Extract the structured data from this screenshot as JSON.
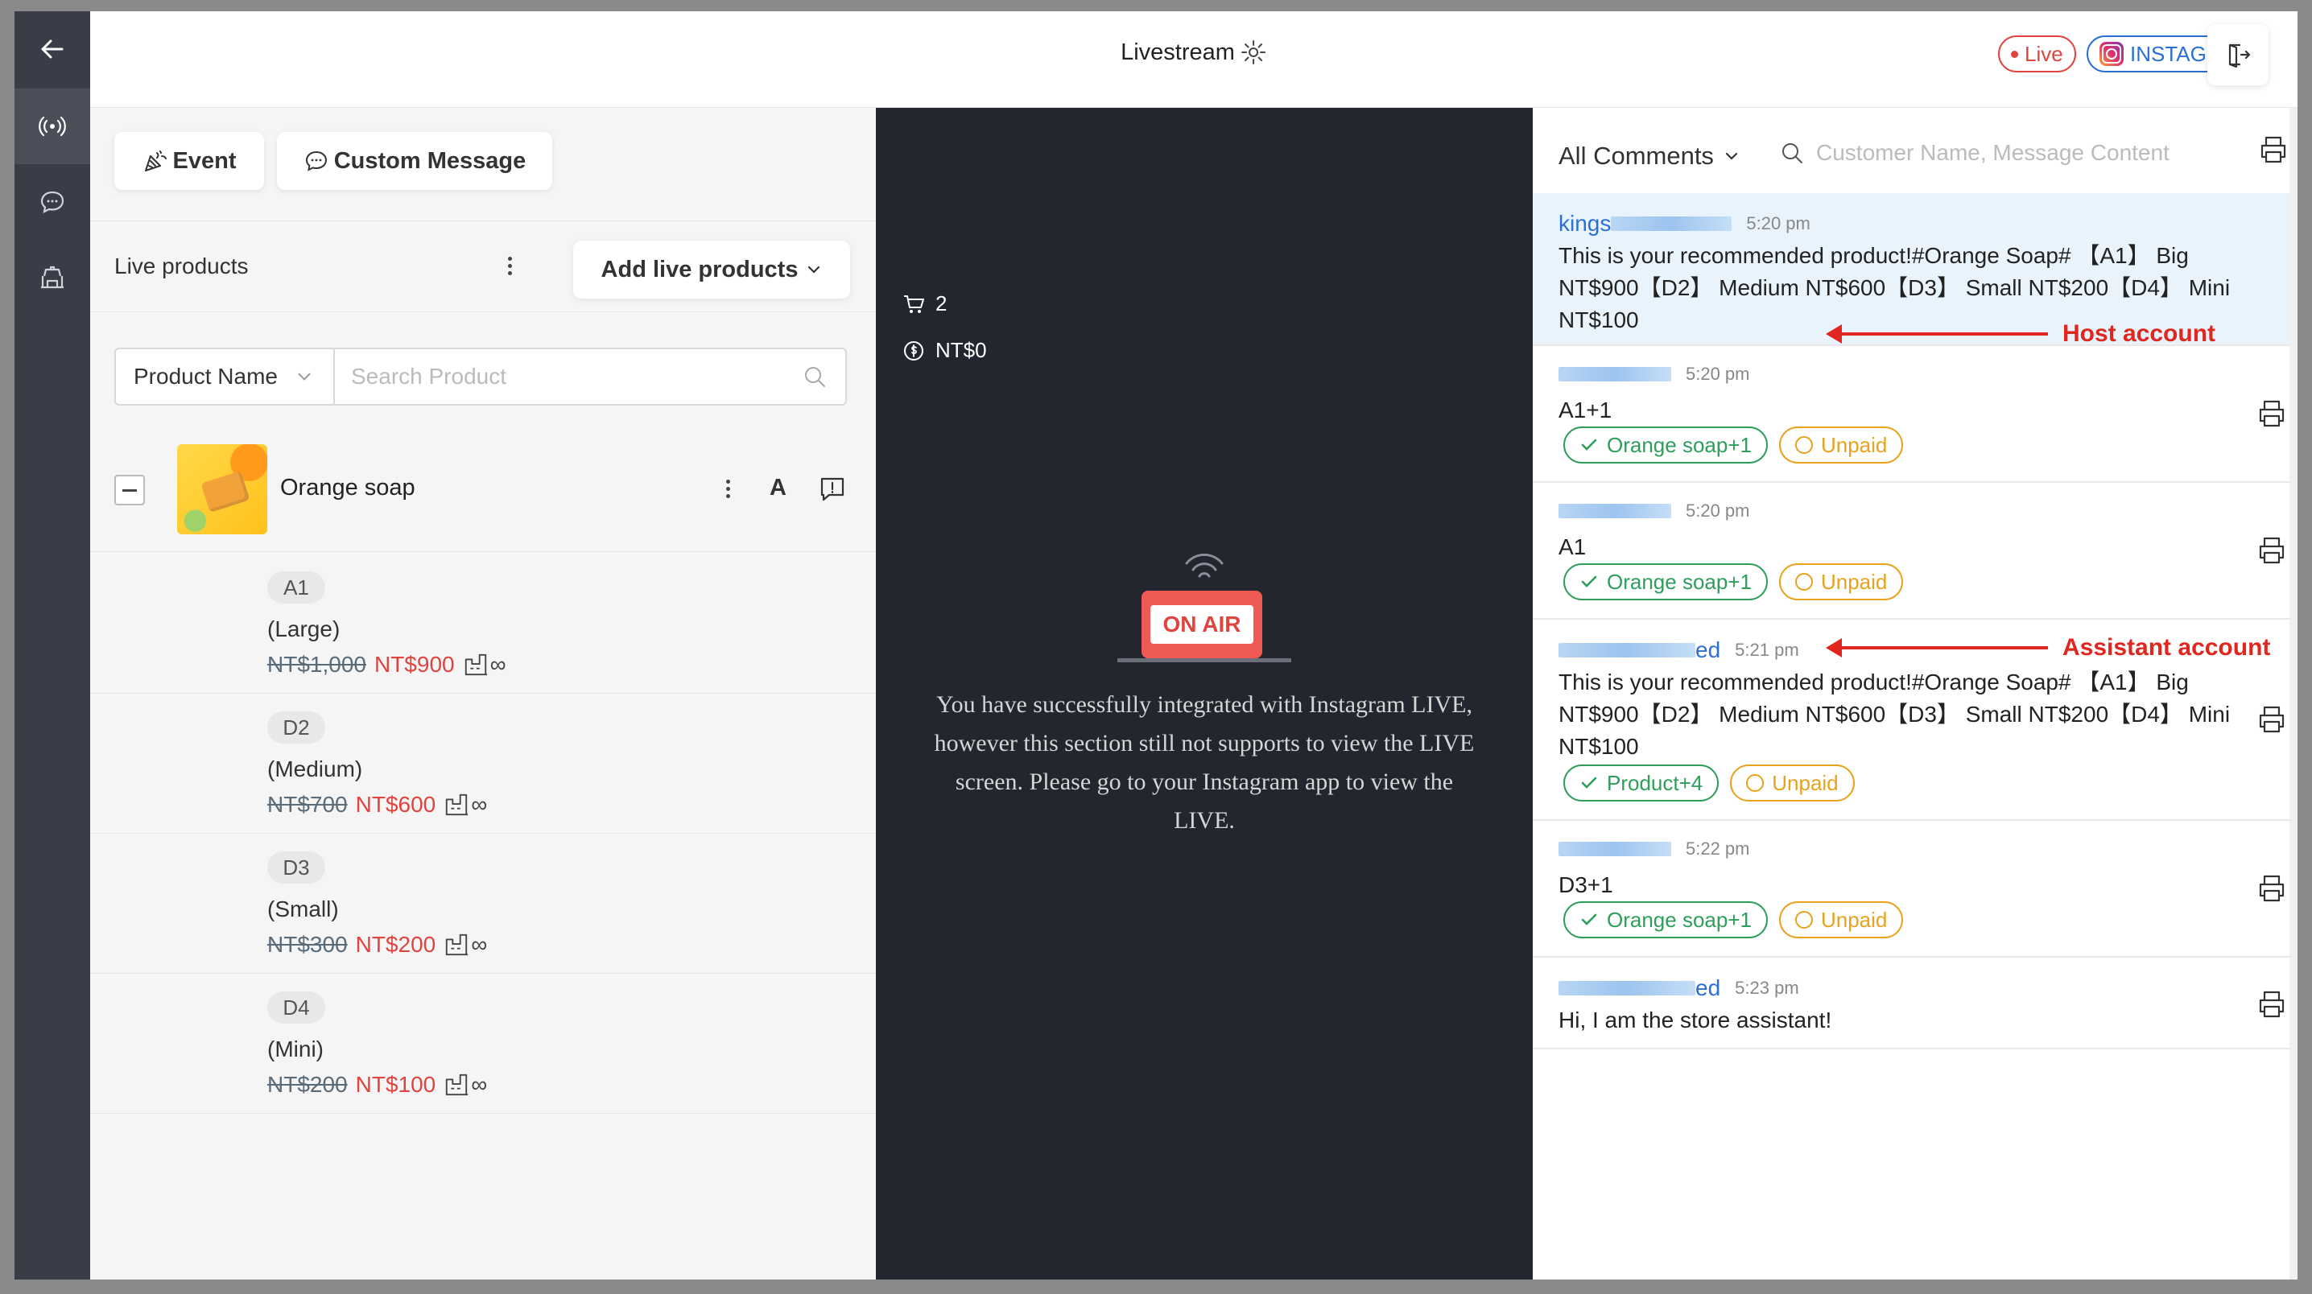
{
  "header": {
    "title": "Livestream",
    "live_label": "Live",
    "platform_label": "INSTAGRAM"
  },
  "rail": {
    "items": [
      "back-arrow-icon",
      "broadcast-icon",
      "chat-icon",
      "store-icon"
    ]
  },
  "left": {
    "event_label": "Event",
    "custom_message_label": "Custom Message",
    "live_products_label": "Live products",
    "add_live_products_label": "Add live products",
    "filter_select": "Product Name",
    "search_placeholder": "Search Product",
    "product": {
      "name": "Orange soap",
      "letter_button": "A"
    },
    "variants": [
      {
        "code": "A1",
        "size": "(Large)",
        "original": "NT$1,000",
        "price": "NT$900",
        "stock": "∞"
      },
      {
        "code": "D2",
        "size": "(Medium)",
        "original": "NT$700",
        "price": "NT$600",
        "stock": "∞"
      },
      {
        "code": "D3",
        "size": "(Small)",
        "original": "NT$300",
        "price": "NT$200",
        "stock": "∞"
      },
      {
        "code": "D4",
        "size": "(Mini)",
        "original": "NT$200",
        "price": "NT$100",
        "stock": "∞"
      }
    ]
  },
  "stream": {
    "cart_count": "2",
    "revenue": "NT$0",
    "on_air_label": "ON AIR",
    "message": "You have successfully integrated with Instagram LIVE, however this section still not supports to view the LIVE screen. Please go to your Instagram app to view the LIVE."
  },
  "comments": {
    "filter_label": "All Comments",
    "search_placeholder": "Customer Name, Message Content",
    "items": [
      {
        "name": "kings",
        "time": "5:20 pm",
        "text": "This is your recommended product!#Orange Soap# 【A1】 Big NT$900【D2】 Medium NT$600【D3】 Small NT$200【D4】 Mini NT$100"
      },
      {
        "name": "",
        "time": "5:20 pm",
        "text": "A1+1",
        "tag1": "Orange soap+1",
        "tag2": "Unpaid"
      },
      {
        "name": "",
        "time": "5:20 pm",
        "text": "A1",
        "tag1": "Orange soap+1",
        "tag2": "Unpaid"
      },
      {
        "name": "ed",
        "time": "5:21 pm",
        "text": "This is your recommended product!#Orange Soap# 【A1】 Big NT$900【D2】 Medium NT$600【D3】 Small NT$200【D4】 Mini NT$100",
        "tag1": "Product+4",
        "tag2": "Unpaid"
      },
      {
        "name": "",
        "time": "5:22 pm",
        "text": "D3+1",
        "tag1": "Orange soap+1",
        "tag2": "Unpaid"
      },
      {
        "name": "ed",
        "time": "5:23 pm",
        "text": "Hi, I am the store assistant!"
      }
    ]
  },
  "annotations": {
    "host": "Host account",
    "assistant": "Assistant account"
  },
  "colors": {
    "accent_blue": "#2b6fd6",
    "live_red": "#e0443e",
    "paid_green": "#2e9e5b",
    "unpaid_orange": "#e8a21c",
    "annotation_red": "#e0261e"
  }
}
